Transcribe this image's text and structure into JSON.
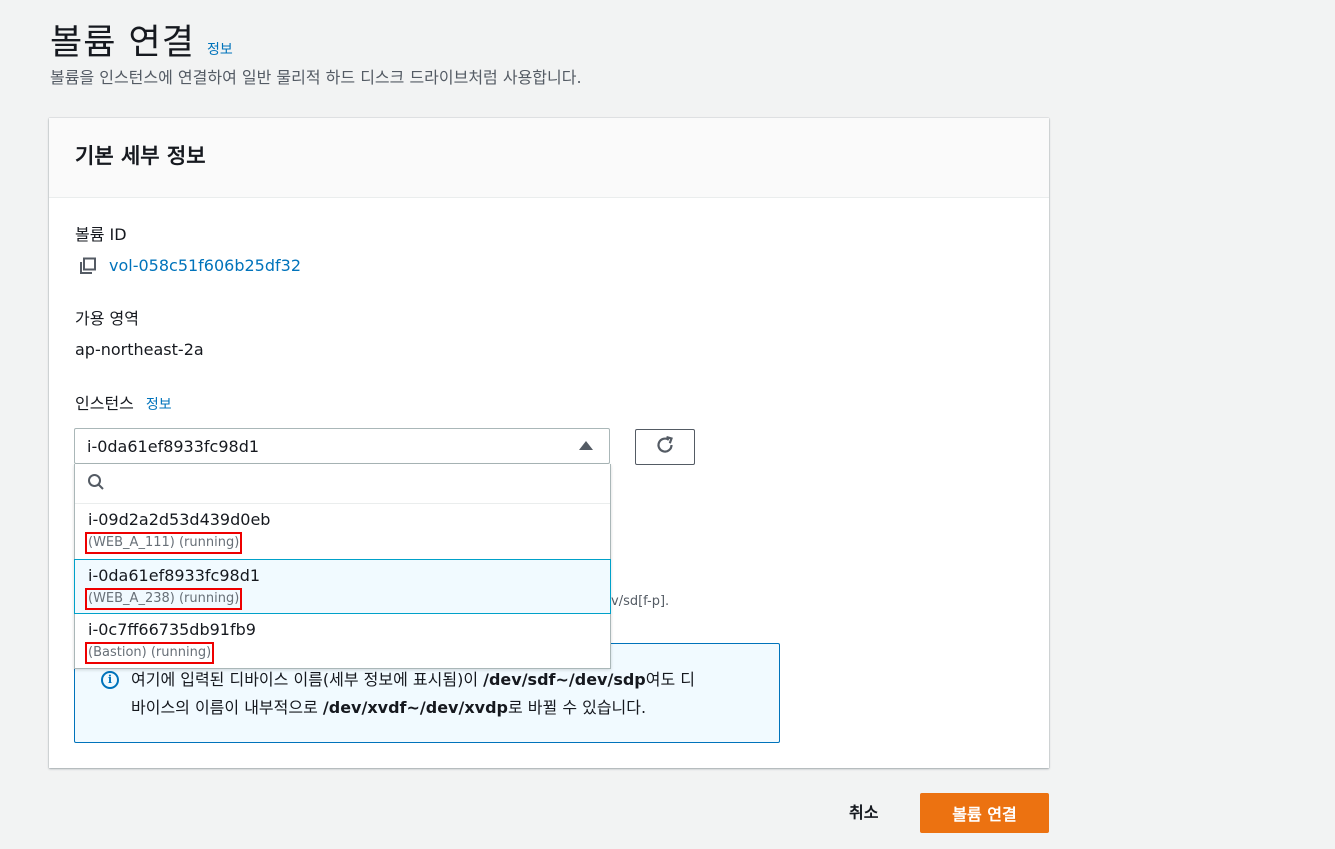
{
  "page": {
    "title": "볼륨 연결",
    "info_link": "정보",
    "description": "볼륨을 인스턴스에 연결하여 일반 물리적 하드 디스크 드라이브처럼 사용합니다."
  },
  "panel": {
    "title": "기본 세부 정보",
    "volume_id_label": "볼륨 ID",
    "volume_id": "vol-058c51f606b25df32",
    "az_label": "가용 영역",
    "az_value": "ap-northeast-2a",
    "instance_label": "인스턴스",
    "instance_info_link": "정보",
    "instance_selected": "i-0da61ef8933fc98d1",
    "hint_fragment": "ev/sd[f-p].",
    "alert": {
      "text1": "여기에 입력된 디바이스 이름(세부 정보에 표시됨)이 ",
      "bold1": "/dev/sdf~/dev/sdp",
      "text2": "여도 디",
      "text3": "바이스의 이름이 내부적으로 ",
      "bold2": "/dev/xvdf~/dev/xvdp",
      "text4": "로 바뀔 수 있습니다."
    }
  },
  "dropdown": {
    "search_placeholder": "",
    "options": [
      {
        "id": "i-09d2a2d53d439d0eb",
        "tag": "(WEB_A_111) (running)"
      },
      {
        "id": "i-0da61ef8933fc98d1",
        "tag": "(WEB_A_238) (running)"
      },
      {
        "id": "i-0c7ff66735db91fb9",
        "tag": "(Bastion) (running)"
      }
    ]
  },
  "footer": {
    "cancel_label": "취소",
    "attach_label": "볼륨 연결"
  },
  "colors": {
    "primary": "#ec7211",
    "link": "#0073bb",
    "highlight_box": "#e00000"
  }
}
